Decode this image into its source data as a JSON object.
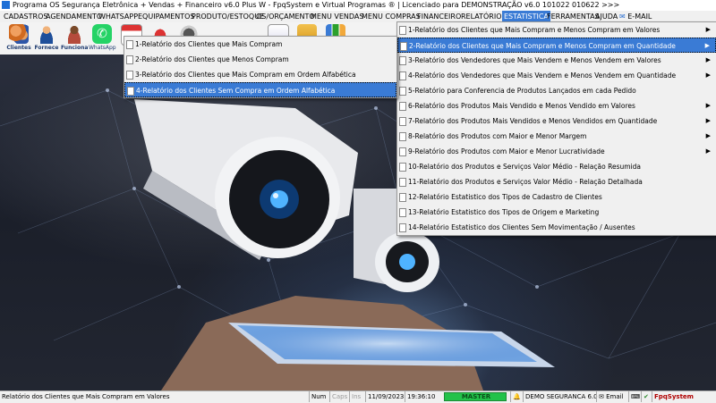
{
  "window": {
    "title": "Programa OS Segurança Eletrônica + Vendas + Financeiro v6.0 Plus W - FpqSystem e Virtual Programas ® | Licenciado para  DEMONSTRAÇÃO v6.0 101022 010622 >>>"
  },
  "menubar": [
    {
      "label": "CADASTROS"
    },
    {
      "label": "AGENDAMENTO"
    },
    {
      "label": "WHATSAPP"
    },
    {
      "label": "EQUIPAMENTOS"
    },
    {
      "label": "PRODUTO/ESTOQUE"
    },
    {
      "label": "OS/ORÇAMENTO"
    },
    {
      "label": "MENU VENDAS"
    },
    {
      "label": "MENU COMPRAS"
    },
    {
      "label": "FINANCEIRO"
    },
    {
      "label": "RELATÓRIOS"
    },
    {
      "label": "ESTATISTICA",
      "active": true
    },
    {
      "label": "FERRAMENTAS"
    },
    {
      "label": "AJUDA"
    },
    {
      "label": "E-MAIL"
    }
  ],
  "toolbar": [
    {
      "label": "Clientes",
      "icon": "people-icon",
      "color": "#e07a2a"
    },
    {
      "label": "Fornece",
      "icon": "supplier-icon",
      "color": "#c26a28"
    },
    {
      "label": "Funciona",
      "icon": "employee-icon",
      "color": "#b86b3a"
    },
    {
      "label": "WhatsApp",
      "icon": "whatsapp-icon",
      "color": "#25d366"
    }
  ],
  "menus": {
    "left": [
      {
        "label": "1-Relatório dos Clientes que Mais Compram"
      },
      {
        "label": "2-Relatório dos Clientes que Menos Compram"
      },
      {
        "label": "3-Relatório dos Clientes que Mais Compram em Ordem Alfabética"
      },
      {
        "label": "4-Relatório dos Clientes Sem Compra em Ordem Alfabética",
        "selected": true
      }
    ],
    "right": [
      {
        "label": "1-Relatório dos Clientes que Mais Compram e Menos Compram em Valores",
        "submenu": true
      },
      {
        "label": "2-Relatório dos Clientes que Mais Compram e Menos Compram em Quantidade",
        "submenu": true,
        "selected": true
      },
      {
        "label": "3-Relatório dos Vendedores que Mais Vendem e Menos Vendem em Valores",
        "submenu": true
      },
      {
        "label": "4-Relatório dos Vendedores que Mais Vendem e Menos Vendem em Quantidade",
        "submenu": true
      },
      {
        "label": "5-Relatório para Conferencia de Produtos Lançados em cada Pedido"
      },
      {
        "label": "6-Relatório dos Produtos Mais Vendido e Menos Vendido em Valores",
        "submenu": true
      },
      {
        "label": "7-Relatório dos Produtos Mais Vendidos e Menos Vendidos em Quantidade",
        "submenu": true
      },
      {
        "label": "8-Relatório dos Produtos com Maior e Menor Margem",
        "submenu": true
      },
      {
        "label": "9-Relatório dos Produtos com Maior e Menor Lucratividade",
        "submenu": true
      },
      {
        "label": "10-Relatório dos Produtos e Serviços Valor Médio - Relação Resumida"
      },
      {
        "label": "11-Relatório dos Produtos e Serviços Valor Médio - Relação Detalhada"
      },
      {
        "label": "12-Relatório Estatistico dos Tipos de Cadastro de Clientes"
      },
      {
        "label": "13-Relatório Estatistico dos Tipos de Origem e Marketing"
      },
      {
        "label": "14-Relatório Estatistico dos Clientes Sem Movimentação / Ausentes"
      }
    ],
    "arrow": "▶"
  },
  "status": {
    "hint": "Relatório dos Clientes que Mais Compram em Valores",
    "num": "Num",
    "caps": "Caps",
    "ins": "Ins",
    "date": "11/09/2023",
    "time": "19:36:10",
    "master": "MASTER",
    "company": "DEMO SEGURANCA 6.0",
    "email": "Email",
    "brand": "FpqSystem"
  }
}
